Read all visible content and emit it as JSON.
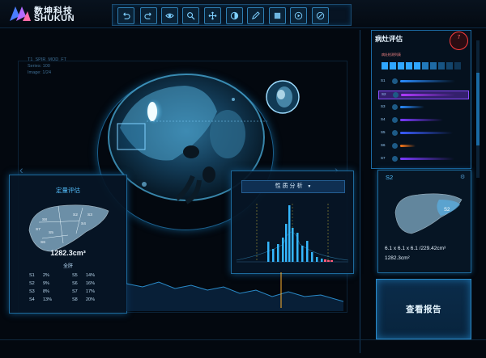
{
  "app": {
    "name_cn": "数坤科技",
    "name_en": "SHUKUN"
  },
  "toolbar": {
    "tools": [
      {
        "icon": "undo-icon"
      },
      {
        "icon": "redo-icon"
      },
      {
        "icon": "eye-icon"
      },
      {
        "icon": "zoom-icon"
      },
      {
        "icon": "pan-icon"
      },
      {
        "icon": "contrast-icon"
      },
      {
        "icon": "pen-icon"
      },
      {
        "icon": "layer-icon"
      },
      {
        "icon": "play-icon"
      },
      {
        "icon": "link-icon"
      }
    ]
  },
  "meta": {
    "line1": "T1_SPIR_MOD_FT",
    "line2": "Series: 100",
    "line3": "Image: 1/24"
  },
  "quant": {
    "title": "定量评估",
    "volume": "1282.3cm³",
    "volume_label": "全肝",
    "segments": [
      {
        "name": "S1",
        "pct": "2%"
      },
      {
        "name": "S5",
        "pct": "14%"
      },
      {
        "name": "S2",
        "pct": "9%"
      },
      {
        "name": "S6",
        "pct": "16%"
      },
      {
        "name": "S3",
        "pct": "8%"
      },
      {
        "name": "S7",
        "pct": "17%"
      },
      {
        "name": "S4",
        "pct": "13%"
      },
      {
        "name": "S8",
        "pct": "20%"
      }
    ],
    "liver_labels": [
      "S2",
      "S3",
      "S4",
      "S5",
      "S6",
      "S7",
      "S8"
    ]
  },
  "property": {
    "title": "性 质 分 析"
  },
  "lesion": {
    "title": "病灶评估",
    "badge_count": "7",
    "subtitle": "病灶检测列表",
    "rows": [
      {
        "label": "S1",
        "color": "#2a8cff",
        "level": 0.9
      },
      {
        "label": "S2",
        "color": "#b13aff",
        "level": 0.88
      },
      {
        "label": "S3",
        "color": "#2a8cff",
        "level": 0.4
      },
      {
        "label": "S4",
        "color": "#7b3aff",
        "level": 0.7
      },
      {
        "label": "S5",
        "color": "#3a5dff",
        "level": 0.85
      },
      {
        "label": "S6",
        "color": "#ff7a1a",
        "level": 0.25
      },
      {
        "label": "S7",
        "color": "#7b3aff",
        "level": 0.88
      }
    ]
  },
  "s2_panel": {
    "title": "S2",
    "dims": "6.1 x 6.1 x 6.1 /229.42cm³",
    "area": "1282.3cm²",
    "label": "S2"
  },
  "report_button": {
    "label": "查看报告"
  },
  "colors": {
    "accent": "#2a8ac8",
    "panel_border": "#1d6a9c",
    "alert": "#ff3b3b"
  }
}
